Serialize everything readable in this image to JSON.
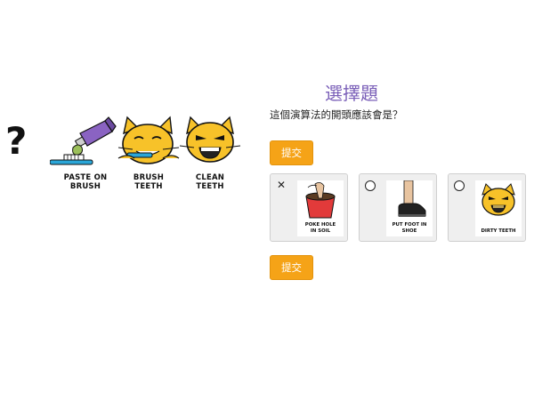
{
  "algorithm_strip": {
    "unknown_step": "?",
    "steps": [
      {
        "label_lines": [
          "PASTE ON",
          "BRUSH"
        ],
        "icon": "toothpaste-brush-icon"
      },
      {
        "label_lines": [
          "BRUSH",
          "TEETH"
        ],
        "icon": "cat-brushing-icon"
      },
      {
        "label_lines": [
          "CLEAN",
          "TEETH"
        ],
        "icon": "cat-clean-teeth-icon"
      }
    ]
  },
  "quiz": {
    "title": "選擇題",
    "prompt": "這個演算法的開頭應該會是？",
    "submit_label": "提交",
    "options": [
      {
        "label_lines": [
          "POKE HOLE",
          "IN SOIL"
        ],
        "icon": "poke-hole-pot-icon",
        "state": "wrong",
        "mark": "✕"
      },
      {
        "label_lines": [
          "PUT FOOT IN",
          "SHOE"
        ],
        "icon": "foot-in-shoe-icon",
        "state": "unselected"
      },
      {
        "label_lines": [
          "DIRTY TEETH"
        ],
        "icon": "cat-dirty-teeth-icon",
        "state": "unselected"
      }
    ]
  },
  "colors": {
    "title": "#7a5fb8",
    "button": "#f5a317",
    "cat": "#f7c229",
    "paste_tube": "#8a63c2",
    "brush_handle": "#2aa6d8",
    "pot": "#e23a3a"
  }
}
